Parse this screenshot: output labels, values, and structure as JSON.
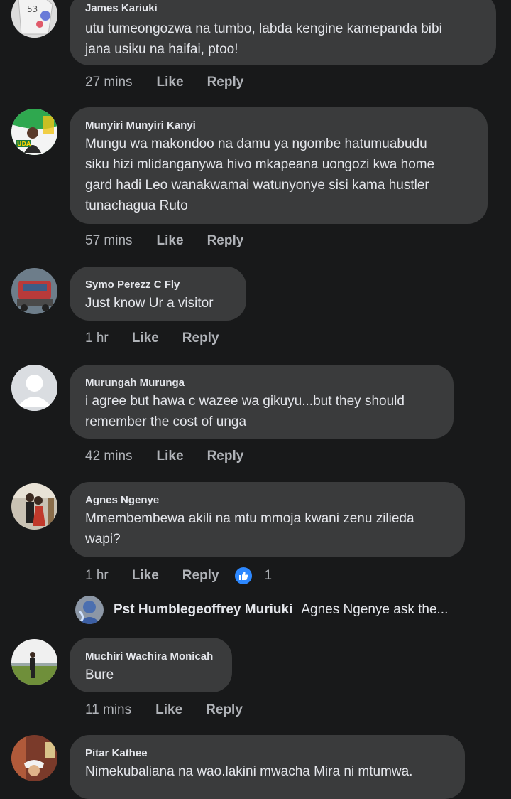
{
  "comments": [
    {
      "author": "James Kariuki",
      "text": [
        "utu tumeongozwa na tumbo, labda kengine kamepanda bibi",
        "jana usiku na haifai, ptoo!"
      ],
      "time": "27 mins",
      "like": "Like",
      "reply": "Reply"
    },
    {
      "author": "Munyiri Munyiri Kanyi",
      "text": [
        "Mungu wa makondoo na damu ya ngombe hatumuabudu",
        "siku hizi mlidanganywa hivo mkapeana uongozi kwa home",
        "gard hadi Leo wanakwamai watunyonye sisi kama hustler",
        "tunachagua Ruto"
      ],
      "time": "57 mins",
      "like": "Like",
      "reply": "Reply",
      "avatar_badge": "UDA"
    },
    {
      "author": "Symo Perezz C Fly",
      "text": [
        "Just know Ur a visitor"
      ],
      "time": "1 hr",
      "like": "Like",
      "reply": "Reply"
    },
    {
      "author": "Murungah Murunga",
      "text": [
        "i agree but hawa c wazee wa gikuyu...but they should",
        "remember the cost of unga"
      ],
      "time": "42 mins",
      "like": "Like",
      "reply": "Reply"
    },
    {
      "author": "Agnes Ngenye",
      "text": [
        "Mmembembewa akili na mtu mmoja kwani zenu zilieda",
        "wapi?"
      ],
      "time": "1 hr",
      "like": "Like",
      "reply": "Reply",
      "reactions": "1"
    },
    {
      "author": "Muchiri Wachira Monicah",
      "text": [
        "Bure"
      ],
      "time": "11 mins",
      "like": "Like",
      "reply": "Reply"
    },
    {
      "author": "Pitar Kathee",
      "text": [
        "Nimekubaliana na wao.lakini mwacha Mira ni mtumwa."
      ]
    }
  ],
  "reply_preview": {
    "author": "Pst Humblegeoffrey Muriuki",
    "text": "Agnes Ngenye ask the..."
  },
  "colors": {
    "background": "#18191a",
    "bubble": "#3a3b3c",
    "text": "#e4e6eb",
    "secondary": "#b0b3b8",
    "like_blue": "#2d88ff"
  }
}
